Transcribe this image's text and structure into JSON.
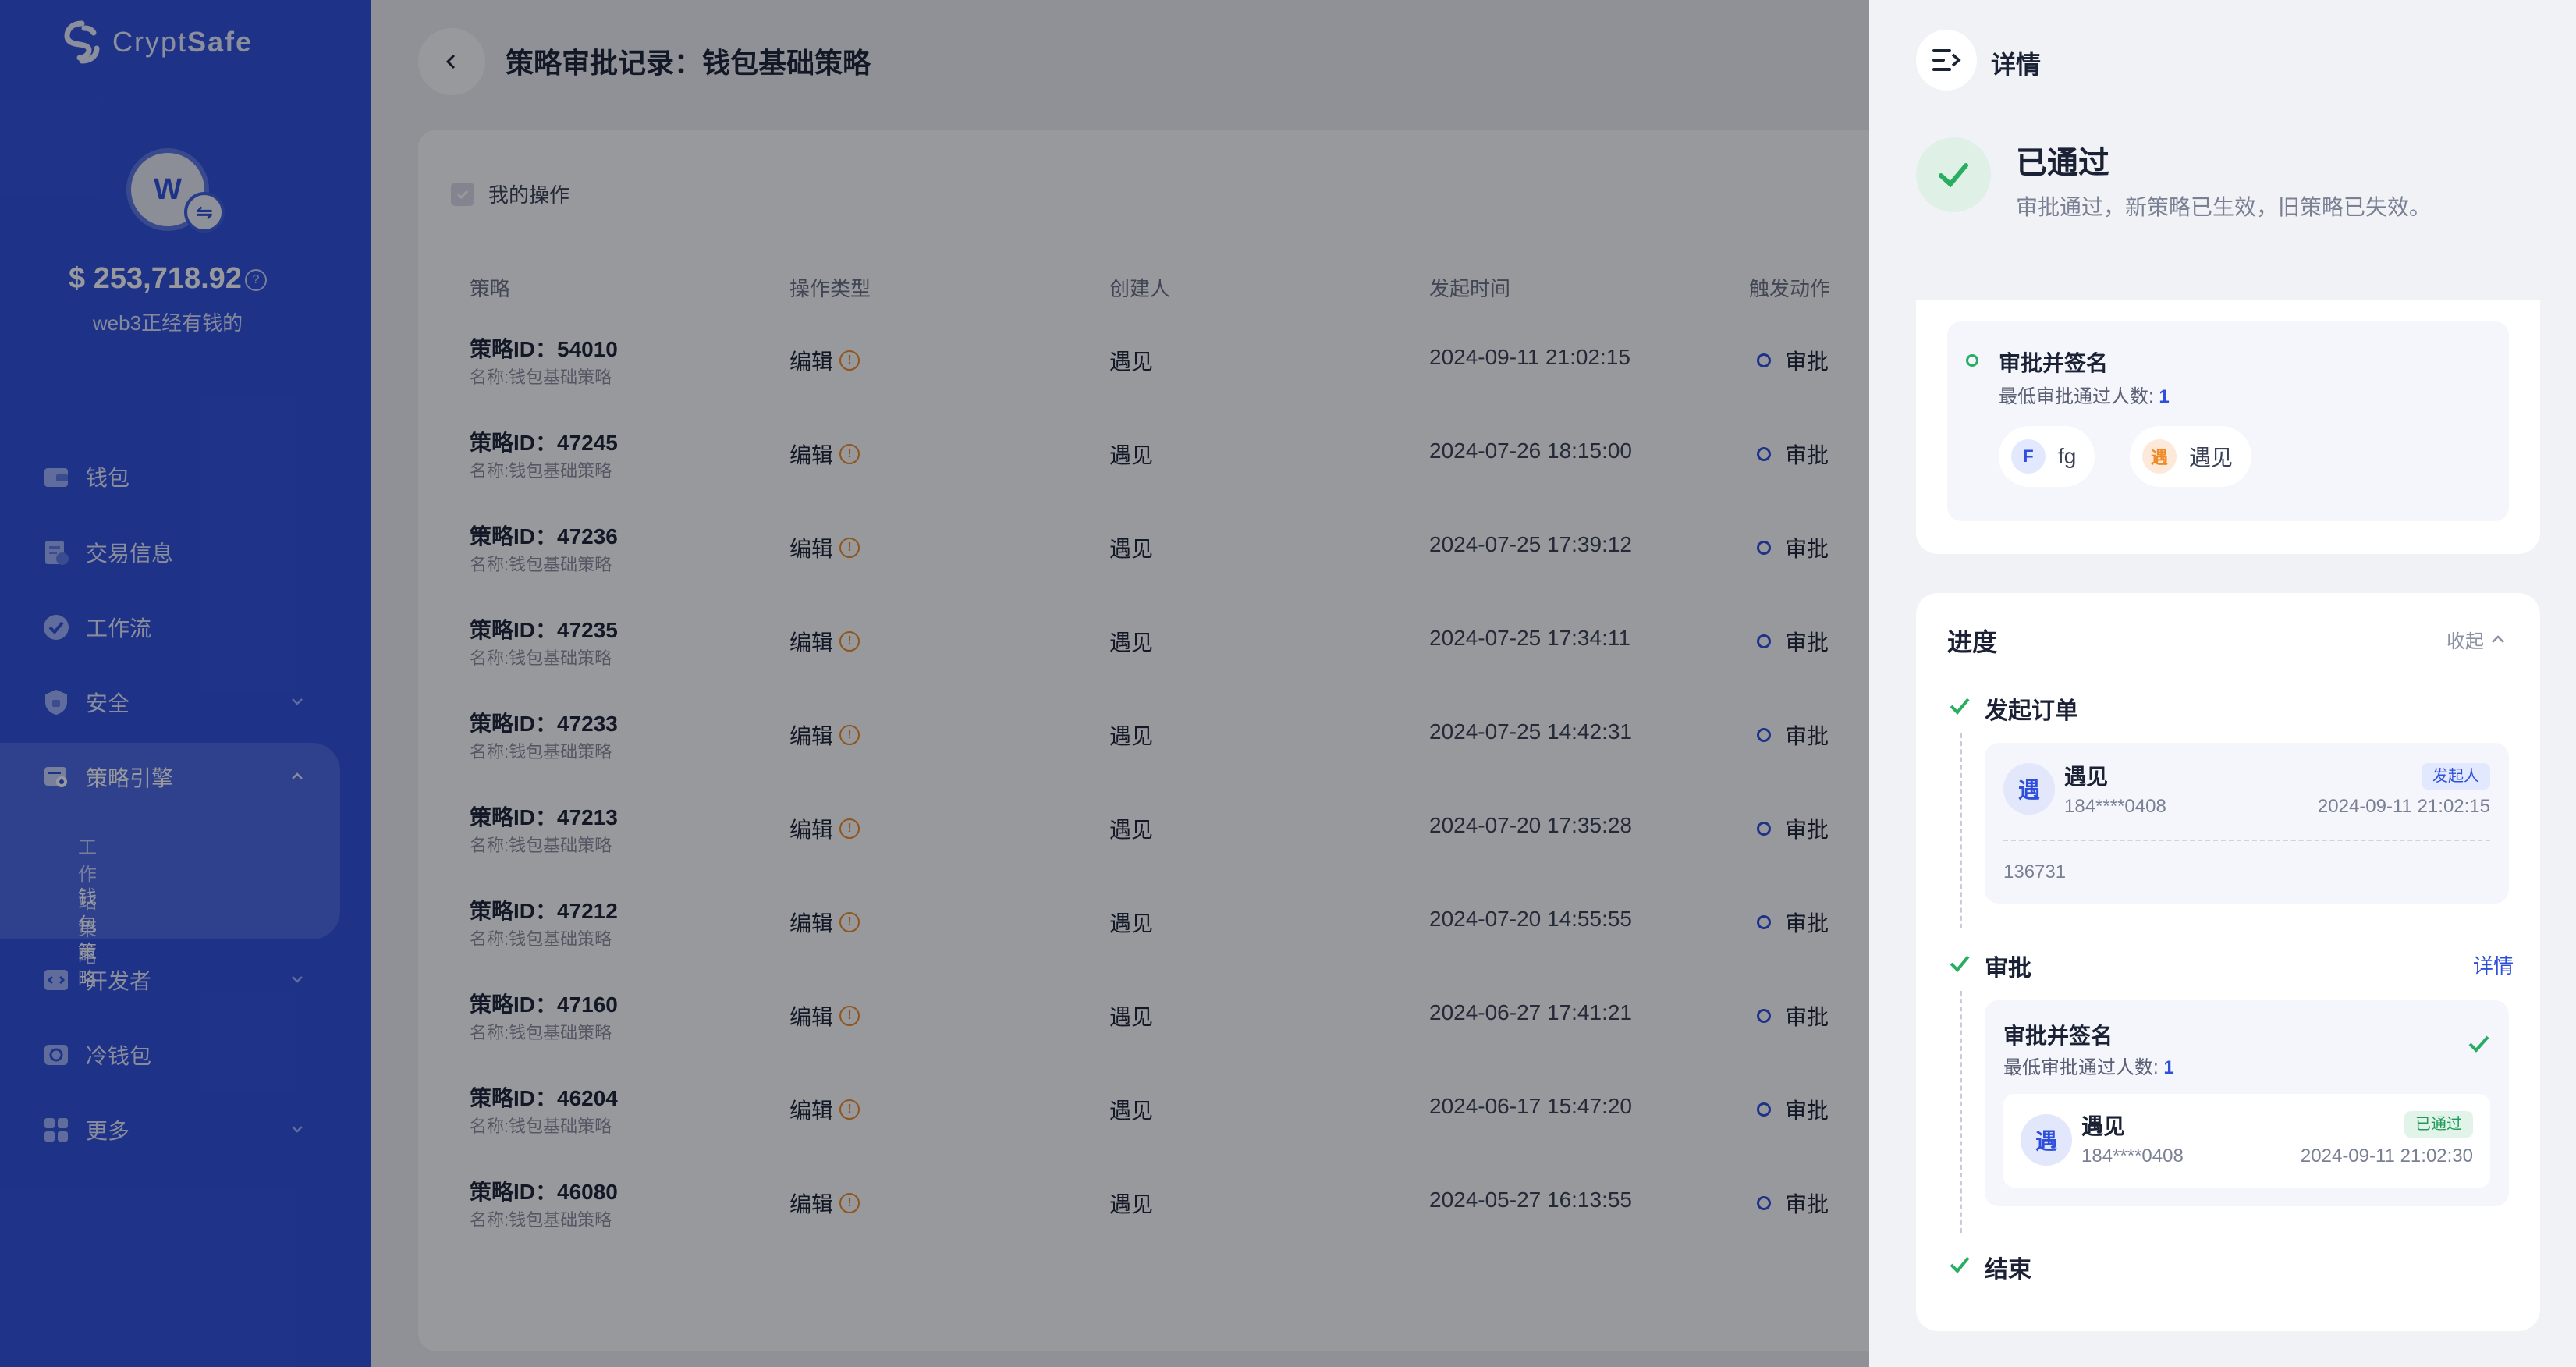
{
  "brand": {
    "name_prefix": "Crypt",
    "name_suffix": "Safe"
  },
  "colors": {
    "primary": "#2e4fdc",
    "success": "#27ae60",
    "warning": "#f08a24"
  },
  "account": {
    "avatar_letter": "W",
    "balance": "$ 253,718.92",
    "wallet_name": "web3正经有钱的"
  },
  "sidebar": {
    "items": [
      {
        "label": "钱包",
        "icon": "wallet-icon"
      },
      {
        "label": "交易信息",
        "icon": "transaction-icon"
      },
      {
        "label": "工作流",
        "icon": "workflow-icon"
      },
      {
        "label": "安全",
        "icon": "shield-icon"
      },
      {
        "label": "策略引擎",
        "icon": "policy-engine-icon"
      },
      {
        "label": "开发者",
        "icon": "developer-icon"
      },
      {
        "label": "冷钱包",
        "icon": "cold-wallet-icon"
      },
      {
        "label": "更多",
        "icon": "more-grid-icon"
      }
    ],
    "sub_items": [
      "工作站策略",
      "钱包策略"
    ]
  },
  "page": {
    "title": "策略审批记录：钱包基础策略",
    "filter_label": "我的操作",
    "columns": [
      "策略",
      "操作类型",
      "创建人",
      "发起时间",
      "触发动作"
    ]
  },
  "rows": [
    {
      "id": "策略ID：54010",
      "name": "名称:钱包基础策略",
      "op": "编辑",
      "creator": "遇见",
      "time": "2024-09-11 21:02:15",
      "action": "审批"
    },
    {
      "id": "策略ID：47245",
      "name": "名称:钱包基础策略",
      "op": "编辑",
      "creator": "遇见",
      "time": "2024-07-26 18:15:00",
      "action": "审批"
    },
    {
      "id": "策略ID：47236",
      "name": "名称:钱包基础策略",
      "op": "编辑",
      "creator": "遇见",
      "time": "2024-07-25 17:39:12",
      "action": "审批"
    },
    {
      "id": "策略ID：47235",
      "name": "名称:钱包基础策略",
      "op": "编辑",
      "creator": "遇见",
      "time": "2024-07-25 17:34:11",
      "action": "审批"
    },
    {
      "id": "策略ID：47233",
      "name": "名称:钱包基础策略",
      "op": "编辑",
      "creator": "遇见",
      "time": "2024-07-25 14:42:31",
      "action": "审批"
    },
    {
      "id": "策略ID：47213",
      "name": "名称:钱包基础策略",
      "op": "编辑",
      "creator": "遇见",
      "time": "2024-07-20 17:35:28",
      "action": "审批"
    },
    {
      "id": "策略ID：47212",
      "name": "名称:钱包基础策略",
      "op": "编辑",
      "creator": "遇见",
      "time": "2024-07-20 14:55:55",
      "action": "审批"
    },
    {
      "id": "策略ID：47160",
      "name": "名称:钱包基础策略",
      "op": "编辑",
      "creator": "遇见",
      "time": "2024-06-27 17:41:21",
      "action": "审批"
    },
    {
      "id": "策略ID：46204",
      "name": "名称:钱包基础策略",
      "op": "编辑",
      "creator": "遇见",
      "time": "2024-06-17 15:47:20",
      "action": "审批"
    },
    {
      "id": "策略ID：46080",
      "name": "名称:钱包基础策略",
      "op": "编辑",
      "creator": "遇见",
      "time": "2024-05-27 16:13:55",
      "action": "审批"
    }
  ],
  "drawer": {
    "title": "详情",
    "status": {
      "title": "已通过",
      "desc": "审批通过，新策略已生效，旧策略已失效。"
    },
    "approval_rule": {
      "title": "审批并签名",
      "min_label": "最低审批通过人数: ",
      "min_value": "1",
      "approvers": [
        {
          "initial": "F",
          "name": "fg"
        },
        {
          "initial": "遇",
          "name": "遇见"
        }
      ]
    },
    "progress": {
      "title": "进度",
      "collapse_label": "收起",
      "steps": {
        "start": {
          "label": "发起订单",
          "user_initial": "遇",
          "user": "遇见",
          "phone": "184****0408",
          "tag": "发起人",
          "time": "2024-09-11 21:02:15",
          "note": "136731"
        },
        "approve": {
          "label": "审批",
          "detail_link": "详情",
          "rule_title": "审批并签名",
          "min_label": "最低审批通过人数: ",
          "min_value": "1",
          "user_initial": "遇",
          "user": "遇见",
          "phone": "184****0408",
          "tag": "已通过",
          "time": "2024-09-11 21:02:30"
        },
        "end": {
          "label": "结束"
        }
      }
    }
  }
}
